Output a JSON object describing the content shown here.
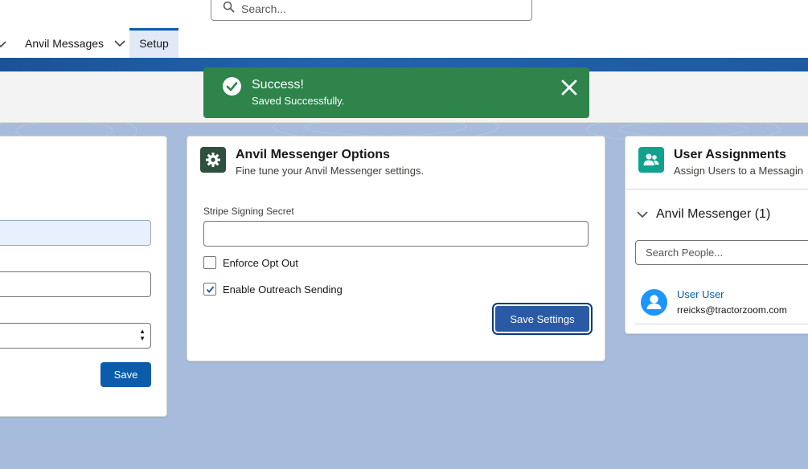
{
  "header": {
    "search_placeholder": "Search..."
  },
  "nav": {
    "app_item_label": "Anvil Messages",
    "setup_tab_label": "Setup"
  },
  "toast": {
    "title": "Success!",
    "message": "Saved Successfully.",
    "color": "#2e844a"
  },
  "left_card": {
    "save_label": "Save"
  },
  "options_card": {
    "title": "Anvil Messenger Options",
    "subtitle": "Fine tune your Anvil Messenger settings.",
    "secret_label": "Stripe Signing Secret",
    "secret_value": "",
    "enforce_opt_out_label": "Enforce Opt Out",
    "enforce_opt_out_checked": false,
    "outreach_label": "Enable Outreach Sending",
    "outreach_checked": true,
    "save_label": "Save Settings"
  },
  "assignments_card": {
    "title": "User Assignments",
    "subtitle": "Assign Users to a Messagin",
    "section_label": "Anvil Messenger (1)",
    "search_placeholder": "Search People...",
    "users": [
      {
        "name": "User User",
        "email": "rreicks@tractorzoom.com"
      }
    ]
  },
  "colors": {
    "brand_blue": "#0b5cab",
    "background": "#a7bcdc",
    "options_icon_bg": "#2f4f3f",
    "assignments_icon_bg": "#10a28f"
  }
}
